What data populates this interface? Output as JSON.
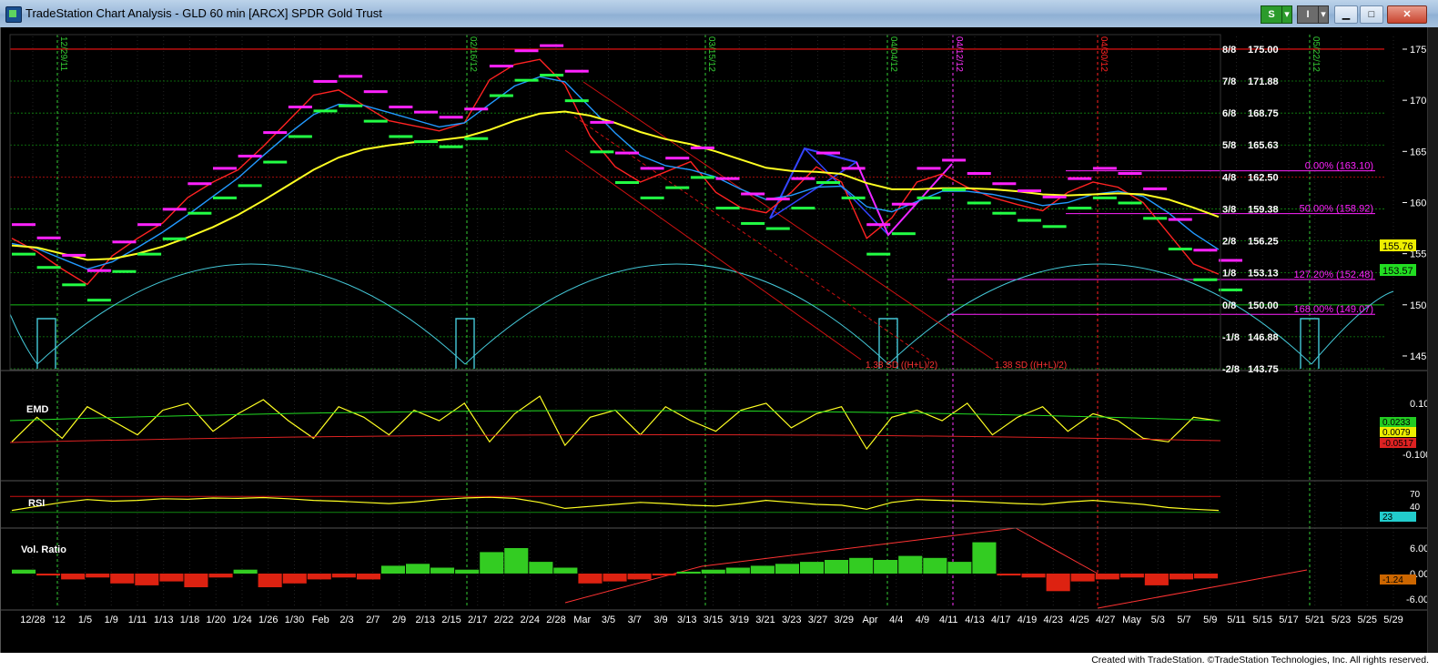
{
  "window": {
    "title": "TradeStation Chart Analysis - GLD 60 min [ARCX] SPDR Gold Trust",
    "s_button": "S",
    "i_button": "I"
  },
  "footer": "Created with TradeStation. ©TradeStation Technologies, Inc. All rights reserved.",
  "colors": {
    "background": "#000000",
    "price_magenta": "#ff22ff",
    "price_green": "#22ff44",
    "cycle_cyan": "#44c8d8",
    "ma_yellow": "#ffff22",
    "ma_blue": "#2299ff",
    "ma_red": "#ff2222",
    "murrey_red": "#cc1111",
    "murrey_green": "#118811"
  },
  "chart_data": [
    {
      "type": "line",
      "panel": "price",
      "symbol": "GLD",
      "interval": "60 min",
      "x_tick_labels": [
        "12/28",
        "'12",
        "1/5",
        "1/9",
        "1/11",
        "1/13",
        "1/18",
        "1/20",
        "1/24",
        "1/26",
        "1/30",
        "Feb",
        "2/3",
        "2/7",
        "2/9",
        "2/13",
        "2/15",
        "2/17",
        "2/22",
        "2/24",
        "2/28",
        "Mar",
        "3/5",
        "3/7",
        "3/9",
        "3/13",
        "3/15",
        "3/19",
        "3/21",
        "3/23",
        "3/27",
        "3/29",
        "Apr",
        "4/4",
        "4/9",
        "4/11",
        "4/13",
        "4/17",
        "4/19",
        "4/23",
        "4/25",
        "4/27",
        "May",
        "5/3",
        "5/7",
        "5/9",
        "5/11",
        "5/15",
        "5/17",
        "5/21",
        "5/23",
        "5/25",
        "5/29"
      ],
      "ylim": [
        143.75,
        175.8
      ],
      "y_ticks": [
        145.0,
        150.0,
        155.0,
        160.0,
        165.0,
        170.0,
        175.0
      ],
      "current_price_labels": [
        "155.76",
        "153.57"
      ],
      "murrey_math_levels": [
        {
          "label": "8/8",
          "value": 175.0,
          "text": "175.00"
        },
        {
          "label": "7/8",
          "value": 171.88,
          "text": "171.88"
        },
        {
          "label": "6/8",
          "value": 168.75,
          "text": "168.75"
        },
        {
          "label": "5/8",
          "value": 165.63,
          "text": "165.63"
        },
        {
          "label": "4/8",
          "value": 162.5,
          "text": "162.50"
        },
        {
          "label": "3/8",
          "value": 159.38,
          "text": "159.38"
        },
        {
          "label": "2/8",
          "value": 156.25,
          "text": "156.25"
        },
        {
          "label": "1/8",
          "value": 153.13,
          "text": "153.13"
        },
        {
          "label": "0/8",
          "value": 150.0,
          "text": "150.00"
        },
        {
          "label": "-1/8",
          "value": 146.88,
          "text": "146.88"
        },
        {
          "label": "-2/8",
          "value": 143.75,
          "text": "143.75"
        }
      ],
      "fibonacci_levels": [
        {
          "text": "0.00% (163.10)",
          "value": 163.1
        },
        {
          "text": "50.00% (158.92)",
          "value": 158.92
        },
        {
          "text": "127.20% (152.48)",
          "value": 152.48
        },
        {
          "text": "168.00% (149.07)",
          "value": 149.07
        }
      ],
      "vertical_date_markers": [
        "12/29/11",
        "02/16/12",
        "03/15/12",
        "04/04/12",
        "04/12/12",
        "04/30/12",
        "05/22/12"
      ],
      "sd_labels": [
        "1.38 SD ((H+L)/2)",
        "1.38 SD ((H+L)/2)"
      ],
      "series": [
        {
          "values": [
            156.5,
            155.2,
            153.5,
            152.0,
            154.8,
            156.5,
            158.0,
            160.5,
            162.0,
            163.2,
            165.5,
            168.0,
            170.5,
            171.0,
            169.5,
            168.0,
            167.5,
            167.0,
            167.8,
            172.0,
            173.5,
            174.0,
            171.5,
            166.5,
            163.5,
            162.0,
            163.0,
            164.0,
            161.0,
            159.5,
            159.0,
            161.0,
            163.5,
            162.0,
            156.5,
            158.5,
            162.0,
            162.8,
            161.5,
            160.5,
            159.8,
            159.2,
            161.0,
            162.0,
            161.5,
            160.0,
            157.0,
            154.0,
            153.0
          ]
        },
        {
          "values": [
            156.0,
            155.5,
            154.5,
            153.5,
            154.2,
            155.6,
            157.1,
            158.8,
            160.6,
            162.4,
            164.6,
            166.7,
            168.6,
            169.6,
            169.5,
            168.8,
            168.1,
            167.4,
            167.8,
            169.6,
            171.4,
            172.3,
            171.8,
            169.3,
            166.8,
            164.6,
            163.6,
            163.2,
            162.5,
            161.3,
            160.3,
            160.7,
            161.5,
            161.6,
            159.6,
            159.1,
            160.1,
            161.1,
            161.1,
            160.8,
            160.3,
            159.7,
            160.0,
            160.8,
            161.1,
            160.6,
            159.0,
            157.0,
            155.4
          ]
        },
        {
          "values": [
            155.8,
            155.6,
            155.0,
            154.4,
            154.5,
            155.0,
            155.7,
            156.6,
            157.6,
            158.8,
            160.2,
            161.7,
            163.2,
            164.4,
            165.2,
            165.6,
            165.9,
            166.1,
            166.4,
            167.1,
            168.0,
            168.7,
            168.9,
            168.5,
            167.8,
            166.9,
            166.2,
            165.7,
            165.0,
            164.2,
            163.4,
            163.1,
            163.0,
            162.8,
            161.9,
            161.3,
            161.3,
            161.4,
            161.4,
            161.3,
            161.1,
            160.8,
            160.7,
            160.8,
            160.9,
            160.8,
            160.3,
            159.5,
            158.6
          ]
        }
      ]
    },
    {
      "type": "line",
      "panel": "EMD",
      "title": "EMD",
      "y_tick_labels": [
        "0.100",
        "-0.1000"
      ],
      "current_value_labels": [
        "0.0233",
        "0.0079",
        "-0.0517"
      ],
      "series": [
        {
          "values": [
            -0.05,
            0.02,
            -0.04,
            0.05,
            0.01,
            -0.03,
            0.04,
            0.06,
            -0.02,
            0.03,
            0.07,
            0.01,
            -0.04,
            0.05,
            0.02,
            -0.03,
            0.04,
            0.01,
            0.06,
            -0.05,
            0.03,
            0.08,
            -0.06,
            0.02,
            0.04,
            -0.03,
            0.05,
            0.01,
            -0.02,
            0.04,
            0.06,
            -0.01,
            0.03,
            0.05,
            -0.07,
            0.02,
            0.04,
            0.01,
            0.06,
            -0.03,
            0.02,
            0.05,
            -0.02,
            0.03,
            0.01,
            -0.04,
            -0.05,
            0.02,
            0.01
          ]
        }
      ]
    },
    {
      "type": "line",
      "panel": "RSI",
      "title": "RSI",
      "y_tick_labels": [
        "70",
        "40"
      ],
      "current_value_label": "23",
      "series": [
        {
          "values": [
            35,
            45,
            55,
            62,
            58,
            60,
            64,
            63,
            66,
            65,
            67,
            64,
            60,
            58,
            55,
            52,
            56,
            62,
            66,
            68,
            65,
            55,
            40,
            45,
            50,
            55,
            52,
            48,
            46,
            52,
            60,
            55,
            50,
            48,
            38,
            55,
            62,
            60,
            58,
            55,
            52,
            50,
            56,
            60,
            55,
            50,
            42,
            38,
            35
          ]
        }
      ]
    },
    {
      "type": "bar",
      "panel": "Vol. Ratio",
      "title": "Vol. Ratio",
      "y_tick_labels": [
        "6.00",
        "0.00",
        "-6.00"
      ],
      "current_value_label": "-1.24",
      "series": [
        {
          "values": [
            1.0,
            -0.5,
            -1.5,
            -1.0,
            -2.5,
            -3.0,
            -2.0,
            -3.5,
            -1.0,
            1.0,
            -3.5,
            -2.5,
            -1.5,
            -1.0,
            -1.5,
            2.0,
            2.5,
            1.5,
            1.0,
            5.5,
            6.5,
            3.0,
            1.5,
            -2.5,
            -2.0,
            -1.5,
            -0.5,
            0.5,
            1.0,
            1.5,
            2.0,
            2.5,
            3.0,
            3.5,
            4.0,
            3.5,
            4.5,
            4.0,
            3.0,
            8.0,
            -0.5,
            -1.0,
            -4.5,
            -2.0,
            -1.5,
            -1.0,
            -3.0,
            -1.5,
            -1.24
          ]
        }
      ]
    }
  ]
}
